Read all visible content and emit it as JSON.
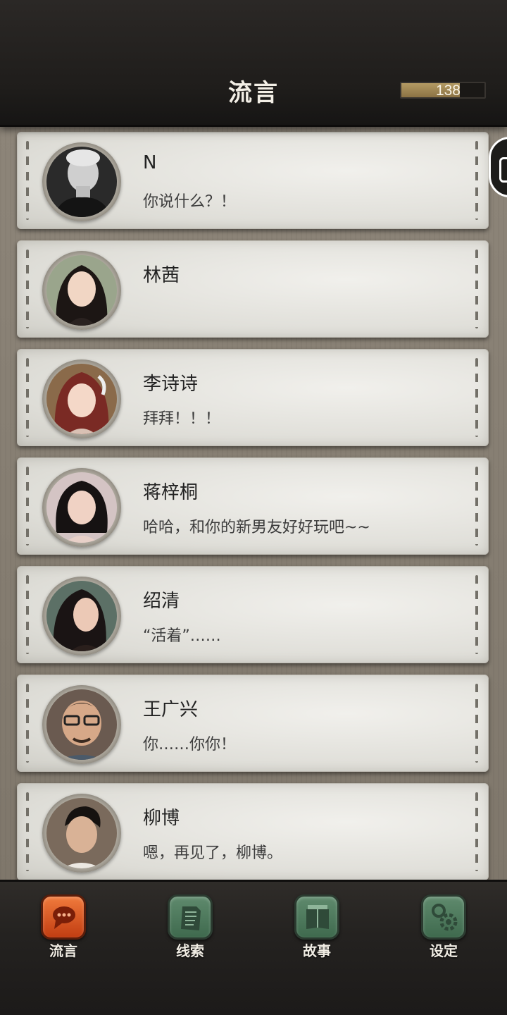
{
  "header": {
    "title": "流言",
    "counter": "138",
    "counter_fraction": 0.7
  },
  "conversations": [
    {
      "name": "N",
      "message": "你说什么？！"
    },
    {
      "name": "林茜",
      "message": ""
    },
    {
      "name": "李诗诗",
      "message": "拜拜！！！"
    },
    {
      "name": "蒋梓桐",
      "message": "哈哈，和你的新男友好好玩吧~~"
    },
    {
      "name": "绍清",
      "message": "“活着”……"
    },
    {
      "name": "王广兴",
      "message": "你……你你！"
    },
    {
      "name": "柳博",
      "message": "嗯，再见了，柳博。"
    }
  ],
  "nav": [
    {
      "label": "流言",
      "icon": "chat-bubble-icon",
      "active": true
    },
    {
      "label": "线索",
      "icon": "document-icon",
      "active": false
    },
    {
      "label": "故事",
      "icon": "book-icon",
      "active": false
    },
    {
      "label": "设定",
      "icon": "gear-icon",
      "active": false
    }
  ],
  "colors": {
    "accent": "#d9541c",
    "nav_green": "#4f7a5d"
  }
}
